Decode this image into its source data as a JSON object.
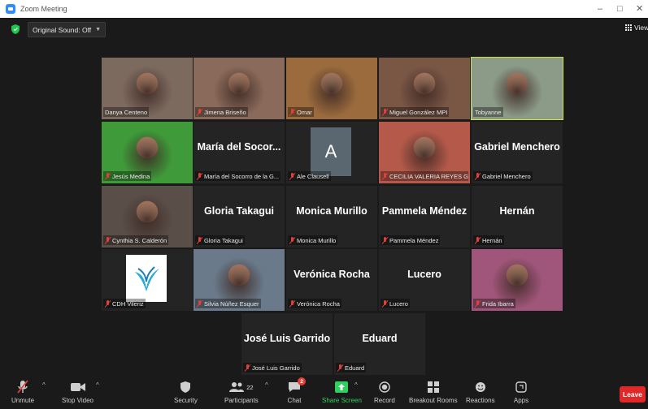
{
  "window": {
    "title": "Zoom Meeting",
    "minimize": "–",
    "restore": "□",
    "close": "✕"
  },
  "topbar": {
    "original_sound": "Original Sound: Off",
    "view": "View"
  },
  "participants": [
    {
      "label": "Danya Centeno",
      "muted": false,
      "type": "video",
      "bg": "#7d6a5f"
    },
    {
      "label": "Jimena Briseño",
      "muted": true,
      "type": "video",
      "bg": "#8a6a5a"
    },
    {
      "label": "Omar",
      "muted": true,
      "type": "video",
      "bg": "#9b6b3d"
    },
    {
      "label": "Miguel González MPI",
      "muted": true,
      "type": "video",
      "bg": "#7a5645"
    },
    {
      "label": "Tobyanne",
      "muted": false,
      "type": "video",
      "bg": "#8c9a88",
      "active": true
    },
    {
      "label": "Jesús Medina",
      "muted": true,
      "type": "video",
      "bg": "#3f9a3a"
    },
    {
      "name": "María del Socor...",
      "label": "María del Socorro de la G...",
      "muted": true,
      "type": "name"
    },
    {
      "avatar": "A",
      "label": "Ale Clausell",
      "muted": true,
      "type": "avatar"
    },
    {
      "label": "CECILIA VALERIA REYES G...",
      "muted": true,
      "type": "video",
      "bg": "#b55a4a"
    },
    {
      "name": "Gabriel Menchero",
      "label": "Gabriel Menchero",
      "muted": true,
      "type": "name"
    },
    {
      "label": "Cynthia S. Calderón",
      "muted": true,
      "type": "video",
      "bg": "#5a4e48"
    },
    {
      "name": "Gloria Takagui",
      "label": "Gloria Takagui",
      "muted": true,
      "type": "name"
    },
    {
      "name": "Monica Murillo",
      "label": "Monica Murillo",
      "muted": true,
      "type": "name"
    },
    {
      "name": "Pammela Méndez",
      "label": "Pammela Méndez",
      "muted": true,
      "type": "name"
    },
    {
      "name": "Hernán",
      "label": "Hernán",
      "muted": true,
      "type": "name"
    },
    {
      "label": "CDH Vileriz",
      "muted": true,
      "type": "logo"
    },
    {
      "label": "Silvia Núñez Esquer",
      "muted": true,
      "type": "video",
      "bg": "#6a7a8a"
    },
    {
      "name": "Verónica Rocha",
      "label": "Verónica Rocha",
      "muted": true,
      "type": "name"
    },
    {
      "name": "Lucero",
      "label": "Lucero",
      "muted": true,
      "type": "name"
    },
    {
      "label": "Frida Ibarra",
      "muted": true,
      "type": "video",
      "bg": "#a0567a"
    },
    {
      "name": "José Luis Garrido",
      "label": "José Luis Garrido",
      "muted": true,
      "type": "name"
    },
    {
      "name": "Eduard",
      "label": "Eduard",
      "muted": true,
      "type": "name"
    }
  ],
  "toolbar": {
    "unmute": "Unmute",
    "stop_video": "Stop Video",
    "security": "Security",
    "participants": "Participants",
    "participants_count": "22",
    "chat": "Chat",
    "chat_badge": "2",
    "share_screen": "Share Screen",
    "record": "Record",
    "breakout": "Breakout Rooms",
    "reactions": "Reactions",
    "apps": "Apps",
    "leave": "Leave"
  },
  "colors": {
    "active_speaker": "#c9e44a",
    "leave": "#e02828",
    "share": "#2fd05d",
    "muted": "#e0403a",
    "zoom_blue": "#2d8cff"
  }
}
